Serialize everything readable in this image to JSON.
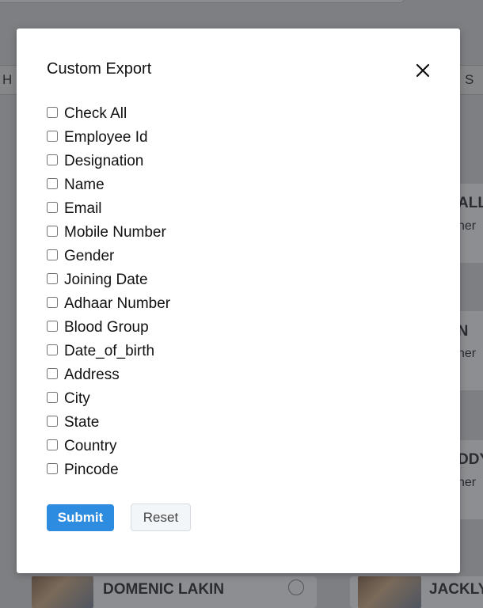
{
  "background": {
    "tab_letters": [
      "H",
      "S"
    ],
    "cards": [
      {
        "name": "ALLIN",
        "sub": "ner"
      },
      {
        "name": "Y N",
        "sub": "ner"
      },
      {
        "name": "DDY",
        "sub": "ner"
      }
    ],
    "bottom_cards": [
      {
        "name": "DOMENIC LAKIN"
      },
      {
        "name": "JACKLY"
      }
    ]
  },
  "modal": {
    "title": "Custom Export",
    "close_icon": "close-icon",
    "options": [
      "Check All",
      "Employee Id",
      "Designation",
      "Name",
      "Email",
      "Mobile Number",
      "Gender",
      "Joining Date",
      "Adhaar Number",
      "Blood Group",
      "Date_of_birth",
      "Address",
      "City",
      "State",
      "Country",
      "Pincode"
    ],
    "submit_label": "Submit",
    "reset_label": "Reset"
  },
  "colors": {
    "overlay": "#7d7f82",
    "primary": "#2d8be0",
    "reset_bg": "#f3f6f9"
  }
}
